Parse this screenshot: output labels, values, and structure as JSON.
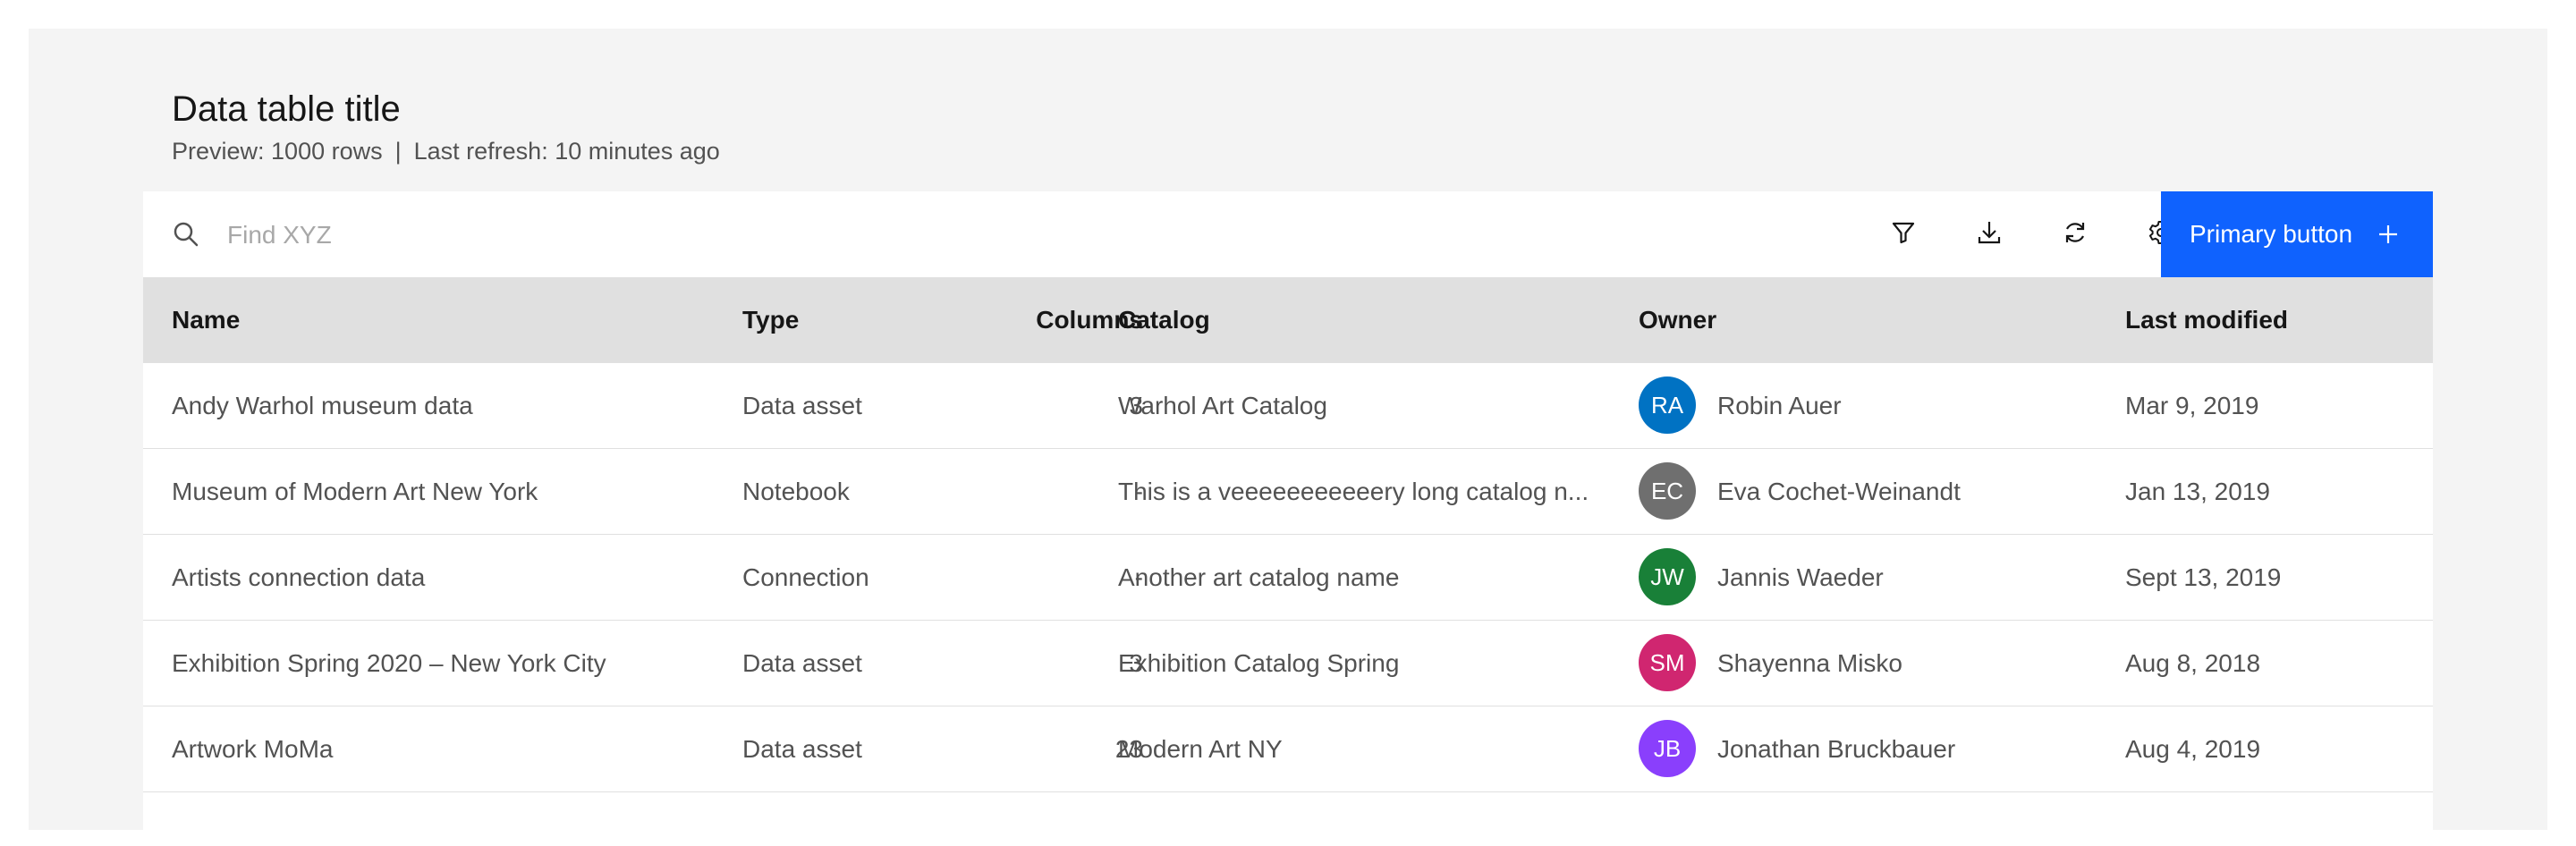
{
  "header": {
    "title": "Data table title",
    "preview": "Preview: 1000 rows",
    "separator": "|",
    "refresh": "Last refresh: 10 minutes ago"
  },
  "toolbar": {
    "search_placeholder": "Find XYZ",
    "icons": [
      "search-icon",
      "filter-icon",
      "download-icon",
      "refresh-icon",
      "settings-icon",
      "plus-icon"
    ],
    "primary_label": "Primary button",
    "primary_color": "#0f62fe"
  },
  "table": {
    "columns": [
      "Name",
      "Type",
      "Columns",
      "Catalog",
      "Owner",
      "Last modified"
    ],
    "rows": [
      {
        "name": "Andy Warhol museum data",
        "type": "Data asset",
        "columns": "3",
        "catalog": "Warhol Art Catalog",
        "initials": "RA",
        "owner": "Robin Auer",
        "avatar_color": "#0072c3",
        "modified": "Mar 9, 2019"
      },
      {
        "name": "Museum of Modern Art New York",
        "type": "Notebook",
        "columns": "-",
        "catalog": "This is a veeeeeeeeeeery long catalog n...",
        "initials": "EC",
        "owner": "Eva Cochet-Weinandt",
        "avatar_color": "#6f6f6f",
        "modified": "Jan 13, 2019"
      },
      {
        "name": "Artists connection data",
        "type": "Connection",
        "columns": "-",
        "catalog": "Another art catalog name",
        "initials": "JW",
        "owner": "Jannis Waeder",
        "avatar_color": "#198038",
        "modified": "Sept 13, 2019"
      },
      {
        "name": "Exhibition Spring 2020 – New York City",
        "type": "Data asset",
        "columns": "3",
        "catalog": "Exhibition Catalog Spring",
        "initials": "SM",
        "owner": "Shayenna Misko",
        "avatar_color": "#d02670",
        "modified": "Aug 8, 2018"
      },
      {
        "name": "Artwork MoMa",
        "type": "Data asset",
        "columns": "23",
        "catalog": "Modern Art NY",
        "initials": "JB",
        "owner": "Jonathan Bruckbauer",
        "avatar_color": "#8a3ffc",
        "modified": "Aug 4, 2019"
      }
    ]
  }
}
